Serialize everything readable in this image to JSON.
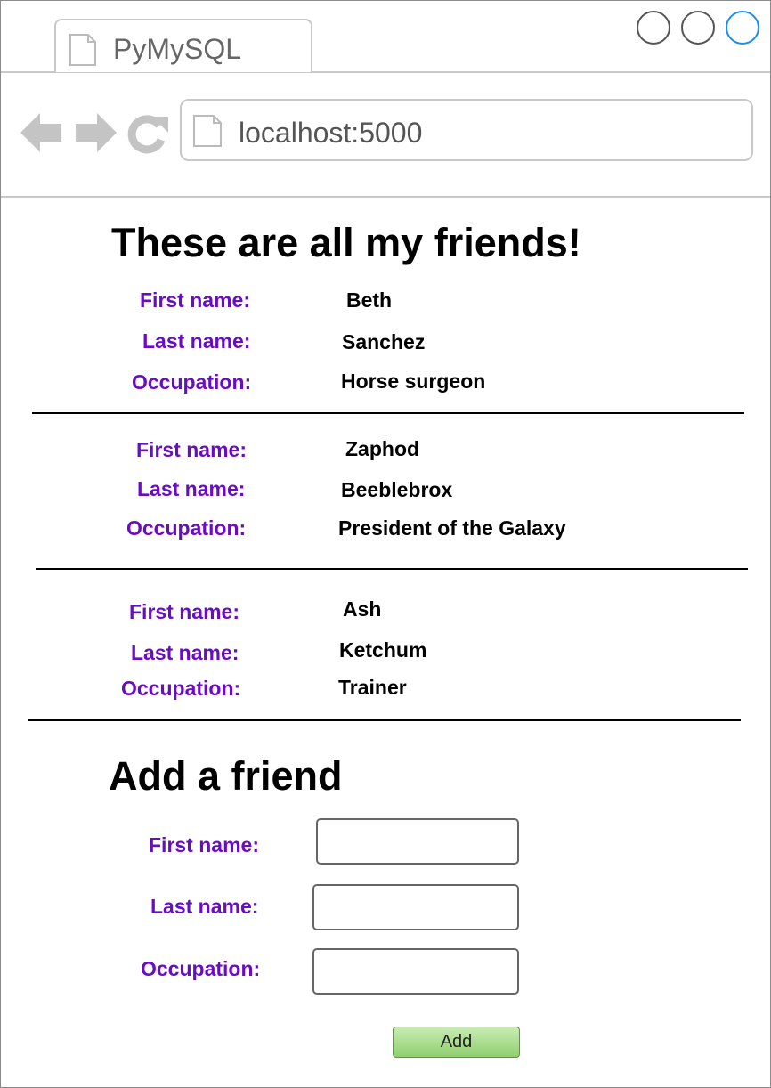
{
  "browser": {
    "tab_title": "PyMySQL",
    "url": "localhost:5000",
    "icons": [
      "back-arrow-icon",
      "forward-arrow-icon",
      "reload-icon",
      "page-icon"
    ]
  },
  "friends_section": {
    "heading": "These are all my friends!",
    "labels": {
      "first": "First name:",
      "last": "Last name:",
      "occupation": "Occupation:"
    },
    "friends": [
      {
        "first": "Beth",
        "last": "Sanchez",
        "occupation": "Horse surgeon"
      },
      {
        "first": "Zaphod",
        "last": "Beeblebrox",
        "occupation": "President of the Galaxy"
      },
      {
        "first": "Ash",
        "last": "Ketchum",
        "occupation": "Trainer"
      }
    ]
  },
  "add_form": {
    "heading": "Add a friend",
    "first_label": "First name:",
    "last_label": "Last name:",
    "occupation_label": "Occupation:",
    "first_value": "",
    "last_value": "",
    "occupation_value": "",
    "submit_label": "Add"
  },
  "colors": {
    "label": "#6b0cc5",
    "button_green": "#8fcf6e",
    "window_blue": "#1b8ef2"
  }
}
